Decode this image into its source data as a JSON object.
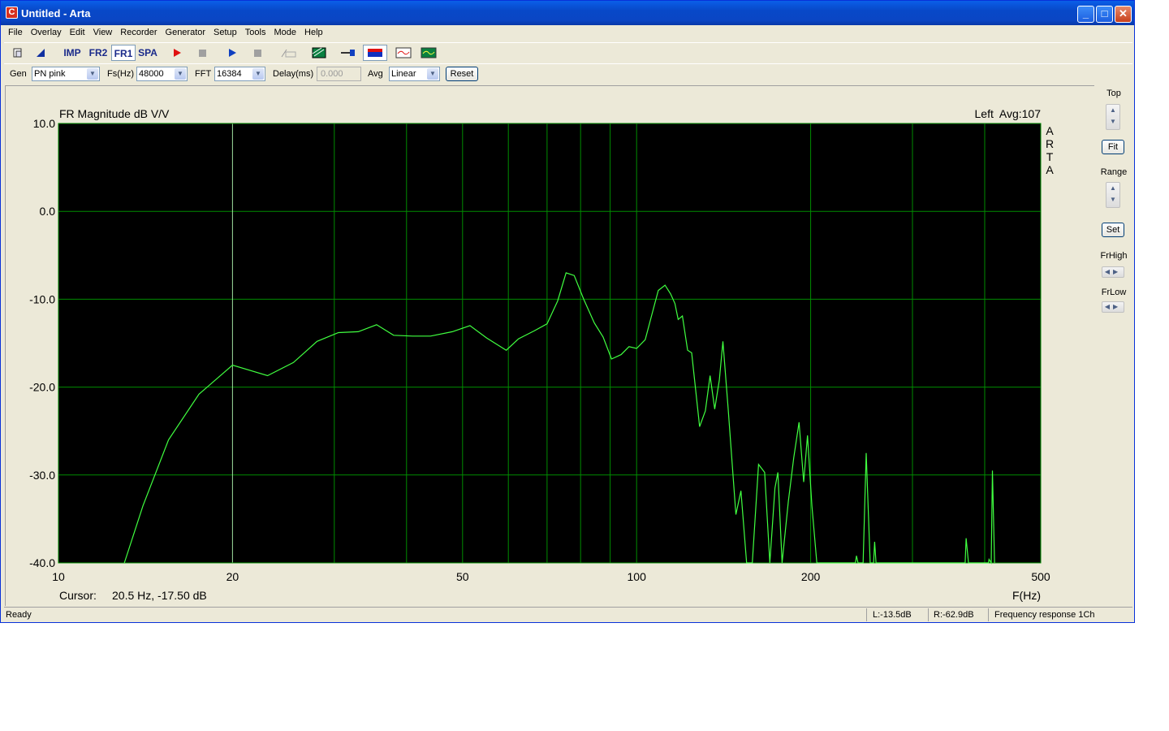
{
  "window": {
    "title": "Untitled - Arta",
    "icon": "arta-app-icon",
    "icon_letter": "C"
  },
  "menu": [
    "File",
    "Overlay",
    "Edit",
    "View",
    "Recorder",
    "Generator",
    "Setup",
    "Tools",
    "Mode",
    "Help"
  ],
  "toolbar": {
    "imp": "IMP",
    "fr2": "FR2",
    "fr1": "FR1",
    "spa": "SPA"
  },
  "genbar": {
    "gen_label": "Gen",
    "gen_value": "PN pink",
    "fs_label": "Fs(Hz)",
    "fs_value": "48000",
    "fft_label": "FFT",
    "fft_value": "16384",
    "delay_label": "Delay(ms)",
    "delay_value": "0.000",
    "avg_label": "Avg",
    "avg_value": "Linear",
    "reset_label": "Reset"
  },
  "plot": {
    "title": "FR Magnitude dB V/V",
    "channel_info": "Left  Avg:107",
    "brand_letters": [
      "A",
      "R",
      "T",
      "A"
    ],
    "cursor_label": "Cursor:",
    "cursor_value": "20.5 Hz, -17.50 dB",
    "xaxis_unit": "F(Hz)"
  },
  "chart_data": {
    "type": "line",
    "title": "FR Magnitude dB V/V",
    "xlabel": "F(Hz)",
    "ylabel": "",
    "xscale": "log",
    "xlim": [
      10,
      500
    ],
    "ylim": [
      -40,
      10
    ],
    "x_ticks": [
      10,
      20,
      50,
      100,
      200,
      500
    ],
    "y_ticks": [
      10,
      0,
      -10,
      -20,
      -30,
      -40
    ],
    "y_tick_labels": [
      "10.0",
      "0.0",
      "-10.0",
      "-20.0",
      "-30.0",
      "-40.0"
    ],
    "grid": true,
    "colors": {
      "background": "#000000",
      "grid": "#008c00",
      "trace": "#40ff40"
    },
    "series": [
      {
        "values": [
          [
            13.0,
            -40.0
          ],
          [
            14.0,
            -33.5
          ],
          [
            15.5,
            -26.0
          ],
          [
            17.5,
            -20.8
          ],
          [
            20.0,
            -17.5
          ],
          [
            23.0,
            -18.7
          ],
          [
            25.5,
            -17.2
          ],
          [
            28.0,
            -14.8
          ],
          [
            30.5,
            -13.8
          ],
          [
            33.0,
            -13.7
          ],
          [
            35.5,
            -12.9
          ],
          [
            38.0,
            -14.1
          ],
          [
            41.0,
            -14.2
          ],
          [
            44.0,
            -14.2
          ],
          [
            48.0,
            -13.7
          ],
          [
            51.5,
            -13.0
          ],
          [
            55.0,
            -14.4
          ],
          [
            59.5,
            -15.8
          ],
          [
            62.5,
            -14.5
          ],
          [
            66.5,
            -13.6
          ],
          [
            70.0,
            -12.8
          ],
          [
            73.0,
            -10.2
          ],
          [
            75.5,
            -7.0
          ],
          [
            78.0,
            -7.3
          ],
          [
            81.0,
            -10.0
          ],
          [
            84.5,
            -12.7
          ],
          [
            87.5,
            -14.3
          ],
          [
            90.5,
            -16.8
          ],
          [
            94.0,
            -16.3
          ],
          [
            97.0,
            -15.4
          ],
          [
            100.0,
            -15.6
          ],
          [
            103.5,
            -14.6
          ],
          [
            106.5,
            -11.5
          ],
          [
            109.0,
            -9.0
          ],
          [
            112.0,
            -8.4
          ],
          [
            114.5,
            -9.4
          ],
          [
            116.5,
            -10.5
          ],
          [
            118.0,
            -12.3
          ],
          [
            120.0,
            -11.9
          ],
          [
            122.5,
            -15.8
          ],
          [
            124.5,
            -16.1
          ],
          [
            128.5,
            -24.5
          ],
          [
            131.5,
            -22.7
          ],
          [
            134.0,
            -18.7
          ],
          [
            136.5,
            -22.5
          ],
          [
            139.0,
            -19.2
          ],
          [
            141.0,
            -14.8
          ],
          [
            144.0,
            -22.5
          ],
          [
            148.5,
            -34.5
          ],
          [
            151.5,
            -31.8
          ],
          [
            155.0,
            -40.0
          ],
          [
            158.5,
            -40.0
          ],
          [
            162.5,
            -28.8
          ],
          [
            166.5,
            -29.7
          ],
          [
            170.0,
            -40.0
          ],
          [
            173.5,
            -31.5
          ],
          [
            175.5,
            -29.7
          ],
          [
            178.5,
            -40.0
          ],
          [
            183.0,
            -33.0
          ],
          [
            187.0,
            -28.0
          ],
          [
            191.0,
            -24.0
          ],
          [
            194.5,
            -30.8
          ],
          [
            197.5,
            -25.5
          ],
          [
            201.0,
            -33.5
          ],
          [
            205.0,
            -40.0
          ],
          [
            239.0,
            -40.0
          ],
          [
            240.0,
            -39.2
          ],
          [
            241.5,
            -40.0
          ],
          [
            246.5,
            -40.0
          ],
          [
            249.5,
            -27.5
          ],
          [
            253.5,
            -40.0
          ],
          [
            257.0,
            -40.0
          ],
          [
            258.0,
            -37.6
          ],
          [
            259.5,
            -40.0
          ],
          [
            370.0,
            -40.0
          ],
          [
            371.5,
            -37.2
          ],
          [
            375.0,
            -40.0
          ],
          [
            406.0,
            -40.0
          ],
          [
            407.0,
            -39.6
          ],
          [
            410.5,
            -40.0
          ],
          [
            412.5,
            -29.5
          ],
          [
            416.0,
            -40.0
          ]
        ]
      }
    ]
  },
  "sidebar": {
    "top_label": "Top",
    "fit_label": "Fit",
    "range_label": "Range",
    "set_label": "Set",
    "frhigh_label": "FrHigh",
    "frlow_label": "FrLow"
  },
  "status": {
    "ready": "Ready",
    "left_level": "L:-13.5dB",
    "right_level": "R:-62.9dB",
    "mode": "Frequency response 1Ch"
  }
}
